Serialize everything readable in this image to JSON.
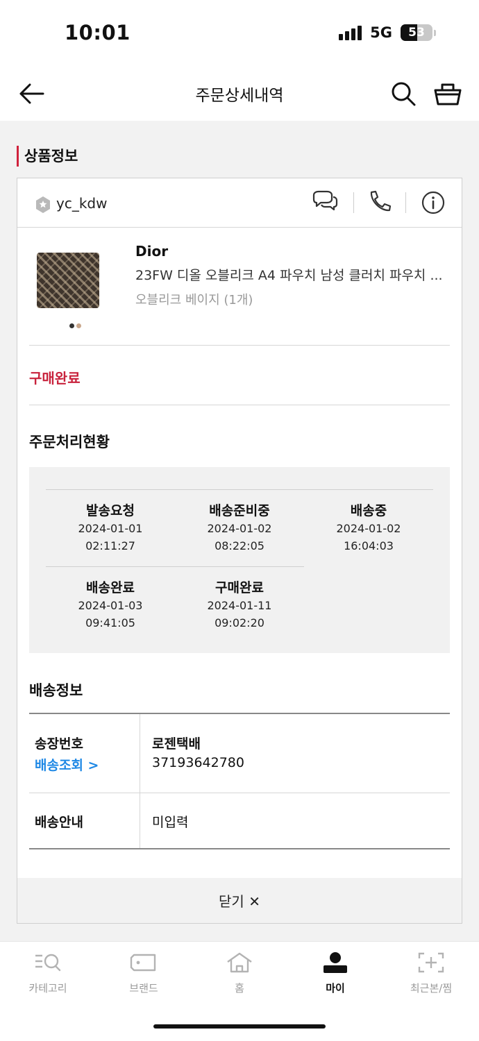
{
  "status_bar": {
    "time": "10:01",
    "network": "5G",
    "battery": "53",
    "battery_level": 0.53
  },
  "header": {
    "title": "주문상세내역",
    "icons": [
      "back-arrow-icon",
      "search-icon",
      "shopping-bag-icon"
    ]
  },
  "section_title": "상품정보",
  "seller": {
    "name": "yc_kdw",
    "actions": [
      "chat-icon",
      "phone-icon",
      "info-icon"
    ]
  },
  "product": {
    "brand": "Dior",
    "name": "23FW 디올 오블리크 A4 파우치 남성 클러치 파우치 ...",
    "option": "오블리크 베이지 (1개)",
    "image_dots": 2
  },
  "order_status": "구매완료",
  "process": {
    "title": "주문처리현황",
    "steps": [
      {
        "label": "발송요청",
        "date": "2024-01-01",
        "time": "02:11:27"
      },
      {
        "label": "배송준비중",
        "date": "2024-01-02",
        "time": "08:22:05"
      },
      {
        "label": "배송중",
        "date": "2024-01-02",
        "time": "16:04:03"
      },
      {
        "label": "배송완료",
        "date": "2024-01-03",
        "time": "09:41:05"
      },
      {
        "label": "구매완료",
        "date": "2024-01-11",
        "time": "09:02:20"
      }
    ]
  },
  "shipping": {
    "title": "배송정보",
    "invoice_label": "송장번호",
    "track_link": "배송조회 >",
    "courier": "로젠택배",
    "invoice_number": "37193642780",
    "notice_label": "배송안내",
    "notice_value": "미입력"
  },
  "close_label": "닫기 ✕",
  "tabs": [
    {
      "label": "카테고리",
      "icon": "category-search-icon",
      "active": false
    },
    {
      "label": "브랜드",
      "icon": "brand-tag-icon",
      "active": false
    },
    {
      "label": "홈",
      "icon": "home-icon",
      "active": false
    },
    {
      "label": "마이",
      "icon": "my-profile-icon",
      "active": true
    },
    {
      "label": "최근본/찜",
      "icon": "recent-wishlist-icon",
      "active": false
    }
  ],
  "colors": {
    "accent_red": "#c8223c",
    "link_blue": "#1e88e5"
  }
}
